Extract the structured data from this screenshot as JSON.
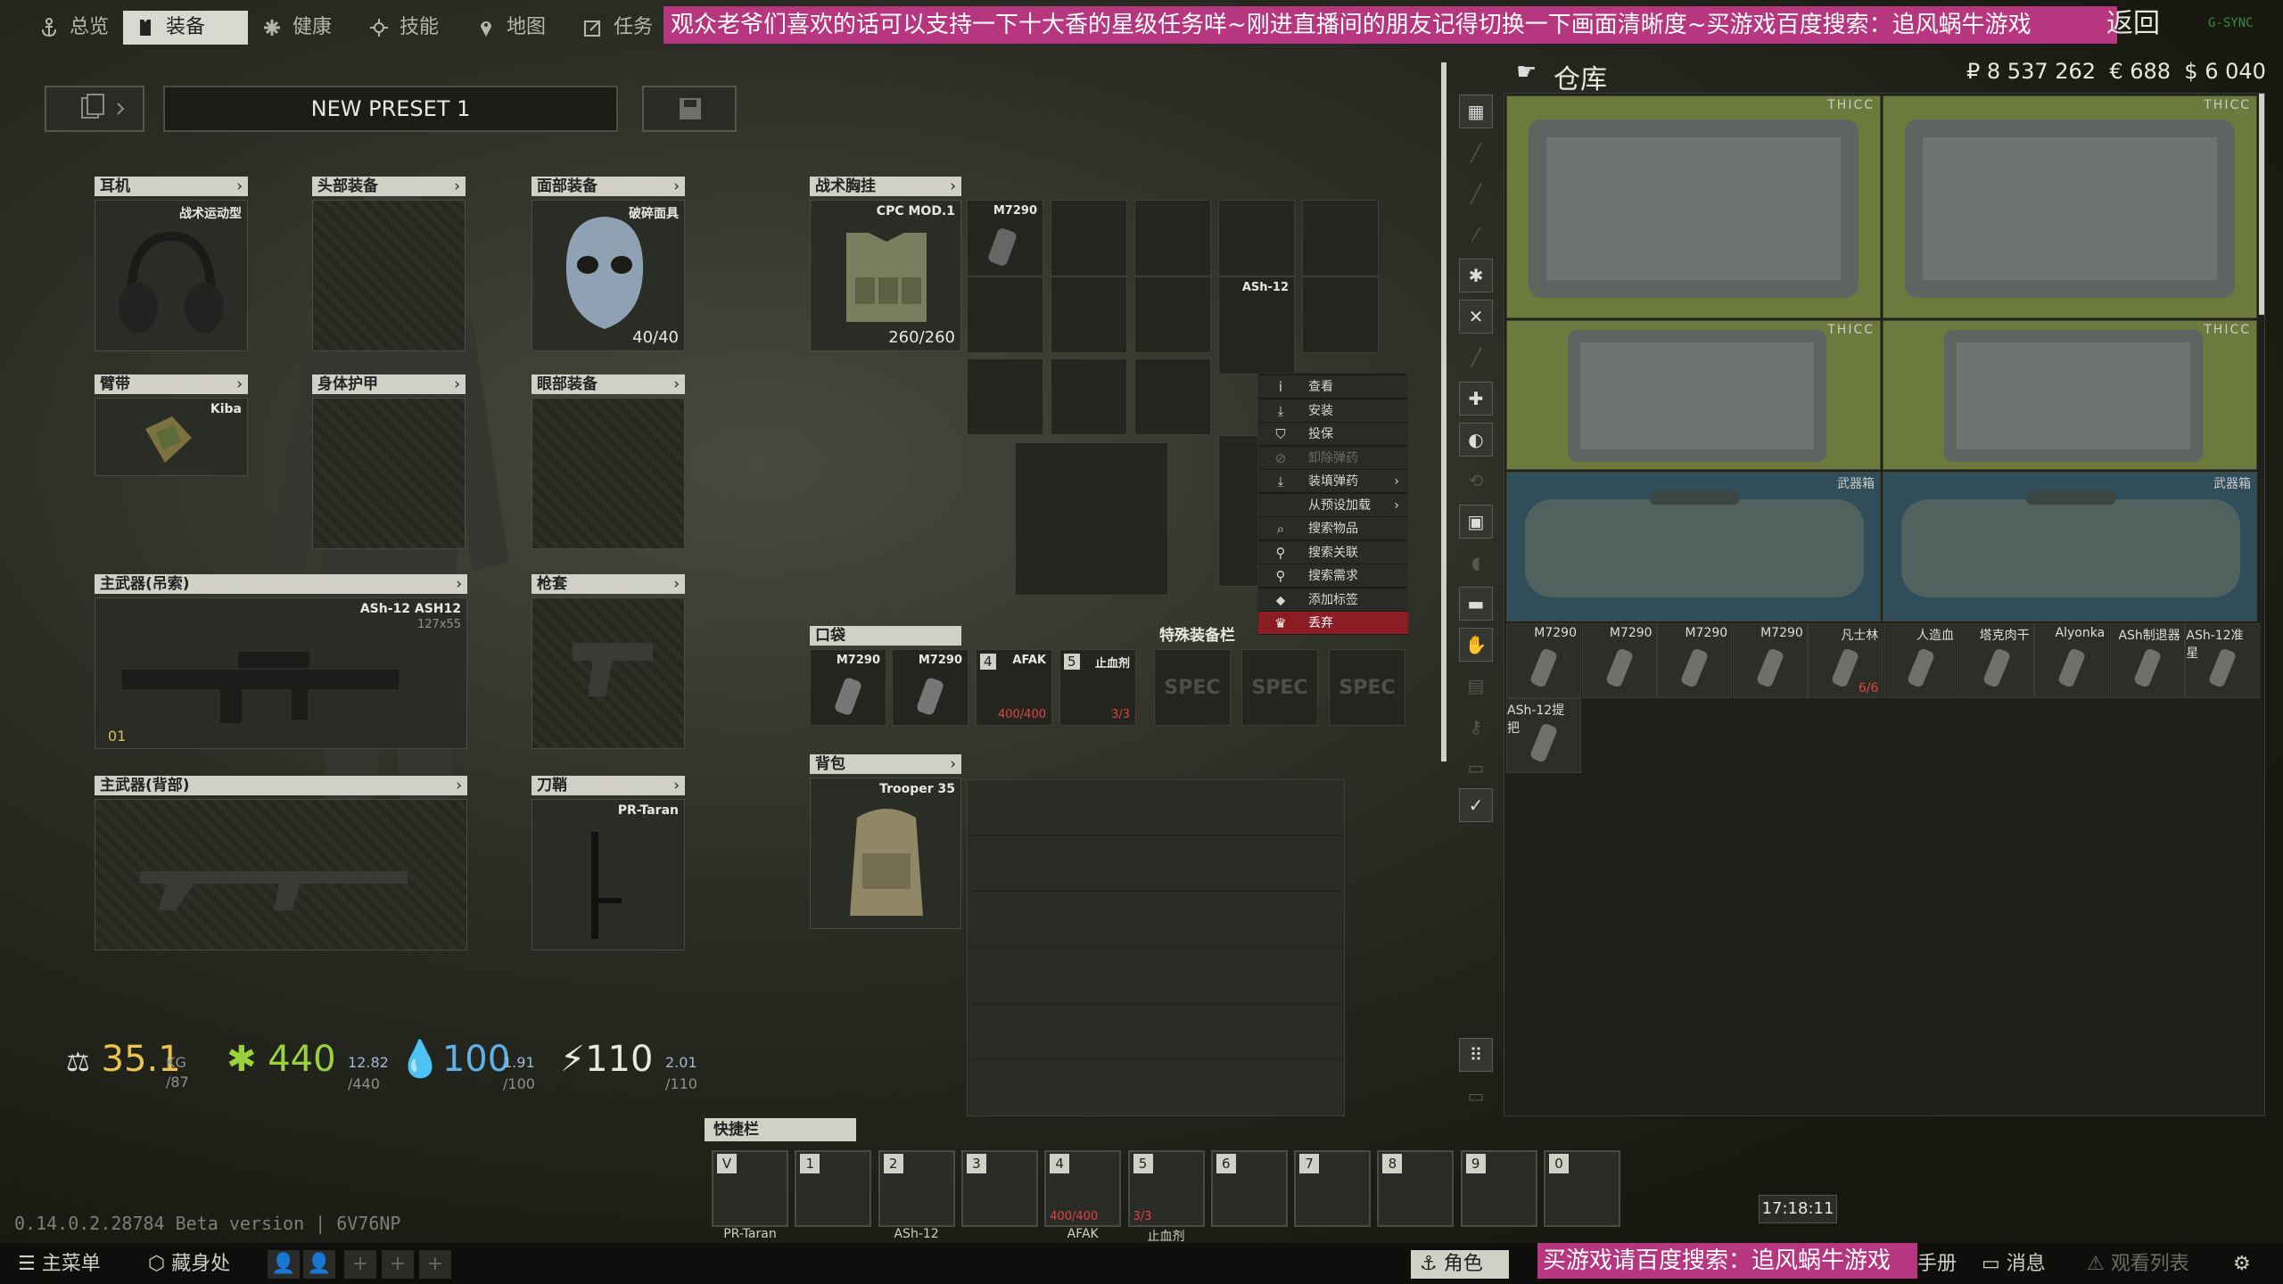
{
  "nav": {
    "tabs": [
      "总览",
      "装备",
      "健康",
      "技能",
      "地图",
      "任务"
    ],
    "active": "装备"
  },
  "overlay": {
    "banner": "观众老爷们喜欢的话可以支持一下十大香的星级任务咩~刚进直播间的朋友记得切换一下画面清晰度~买游戏百度搜索：追风蜗牛游戏",
    "back": "返回",
    "sync": "G-SYNC",
    "bottom_banner": "买游戏请百度搜索：追风蜗牛游戏"
  },
  "preset": {
    "name": "NEW PRESET 1"
  },
  "slots": {
    "earpiece": {
      "label": "耳机",
      "item": "战术运动型"
    },
    "headwear": {
      "label": "头部装备"
    },
    "faceCover": {
      "label": "面部装备",
      "item": "破碎面具",
      "stat": "40/40"
    },
    "armband": {
      "label": "臂带",
      "item": "Kiba"
    },
    "armor": {
      "label": "身体护甲"
    },
    "eyewear": {
      "label": "眼部装备"
    },
    "primary": {
      "label": "主武器(吊索)",
      "item": "ASh-12 ASH12",
      "caliber": "127x55",
      "badge": "01"
    },
    "holster": {
      "label": "枪套"
    },
    "secondary": {
      "label": "主武器(背部)"
    },
    "scabbard": {
      "label": "刀鞘",
      "item": "PR-Taran"
    },
    "rig": {
      "label": "战术胸挂",
      "item": "CPC MOD.1",
      "stat": "260/260",
      "slot_item": "M7290",
      "side_item": "ASh-12"
    },
    "pockets": {
      "label": "口袋",
      "items": [
        {
          "name": "M7290"
        },
        {
          "name": "M7290"
        },
        {
          "name": "AFAK",
          "num": "4",
          "stat": "400/400"
        },
        {
          "name": "止血剂",
          "num": "5",
          "stat": "3/3"
        }
      ]
    },
    "special": {
      "label": "特殊装备栏",
      "items": [
        "SPEC",
        "SPEC",
        "SPEC"
      ]
    },
    "backpack": {
      "label": "背包",
      "item": "Trooper 35"
    }
  },
  "stats": {
    "weight": "35.1",
    "weight_unit": "KG",
    "weight_max": "/87",
    "energy": "440",
    "energy_rate": "12.82",
    "energy_max": "/440",
    "hydration": "100",
    "hydration_rate": "1.91",
    "hydration_max": "/100",
    "stamina": "110",
    "stamina_rate": "2.01",
    "stamina_max": "/110"
  },
  "context_menu": [
    {
      "label": "查看",
      "icon": "i"
    },
    {
      "label": "安装",
      "icon": "⤓"
    },
    {
      "label": "投保",
      "icon": "⛉"
    },
    {
      "label": "卸除弹药",
      "icon": "⊘",
      "disabled": true
    },
    {
      "label": "装填弹药",
      "icon": "⤓",
      "sub": true
    },
    {
      "label": "从预设加载",
      "icon": "",
      "sub": true
    },
    {
      "label": "搜索物品",
      "icon": "⌕"
    },
    {
      "label": "搜索关联",
      "icon": "⚲"
    },
    {
      "label": "搜索需求",
      "icon": "⚲"
    },
    {
      "label": "添加标签",
      "icon": "⬥"
    },
    {
      "label": "丢弃",
      "icon": "♛",
      "danger": true
    }
  ],
  "stash": {
    "title": "仓库",
    "rub": "₽ 8 537 262",
    "eur": "€ 688",
    "usd": "$ 6 040",
    "cases": [
      {
        "label": "THICC"
      },
      {
        "label": "THICC"
      },
      {
        "label": "THICC"
      },
      {
        "label": "THICC"
      },
      {
        "label": "武器箱"
      },
      {
        "label": "武器箱"
      }
    ],
    "items": [
      {
        "label": "M7290"
      },
      {
        "label": "M7290"
      },
      {
        "label": "M7290"
      },
      {
        "label": "M7290"
      },
      {
        "label": "凡士林",
        "count": "6/6"
      },
      {
        "label": "人造血"
      },
      {
        "label": "塔克肉干"
      },
      {
        "label": "Alyonka"
      },
      {
        "label": "ASh制退器"
      },
      {
        "label": "ASh-12准星"
      },
      {
        "label": "ASh-12提把"
      }
    ]
  },
  "quickbar": {
    "label": "快捷栏",
    "slots": [
      {
        "key": "V",
        "label": "PR-Taran"
      },
      {
        "key": "1",
        "label": ""
      },
      {
        "key": "2",
        "label": "ASh-12"
      },
      {
        "key": "3",
        "label": ""
      },
      {
        "key": "4",
        "label": "AFAK",
        "stat": "400/400"
      },
      {
        "key": "5",
        "label": "止血剂",
        "stat": "3/3"
      },
      {
        "key": "6",
        "label": ""
      },
      {
        "key": "7",
        "label": ""
      },
      {
        "key": "8",
        "label": ""
      },
      {
        "key": "9",
        "label": ""
      },
      {
        "key": "0",
        "label": ""
      }
    ]
  },
  "footer": {
    "version": "0.14.0.2.28784 Beta version | 6V76NP",
    "clock": "17:18:11",
    "menu": "主菜单",
    "hideout": "藏身处",
    "character": "角色",
    "handbook": "手册",
    "messages": "消息",
    "watchlist": "观看列表"
  }
}
